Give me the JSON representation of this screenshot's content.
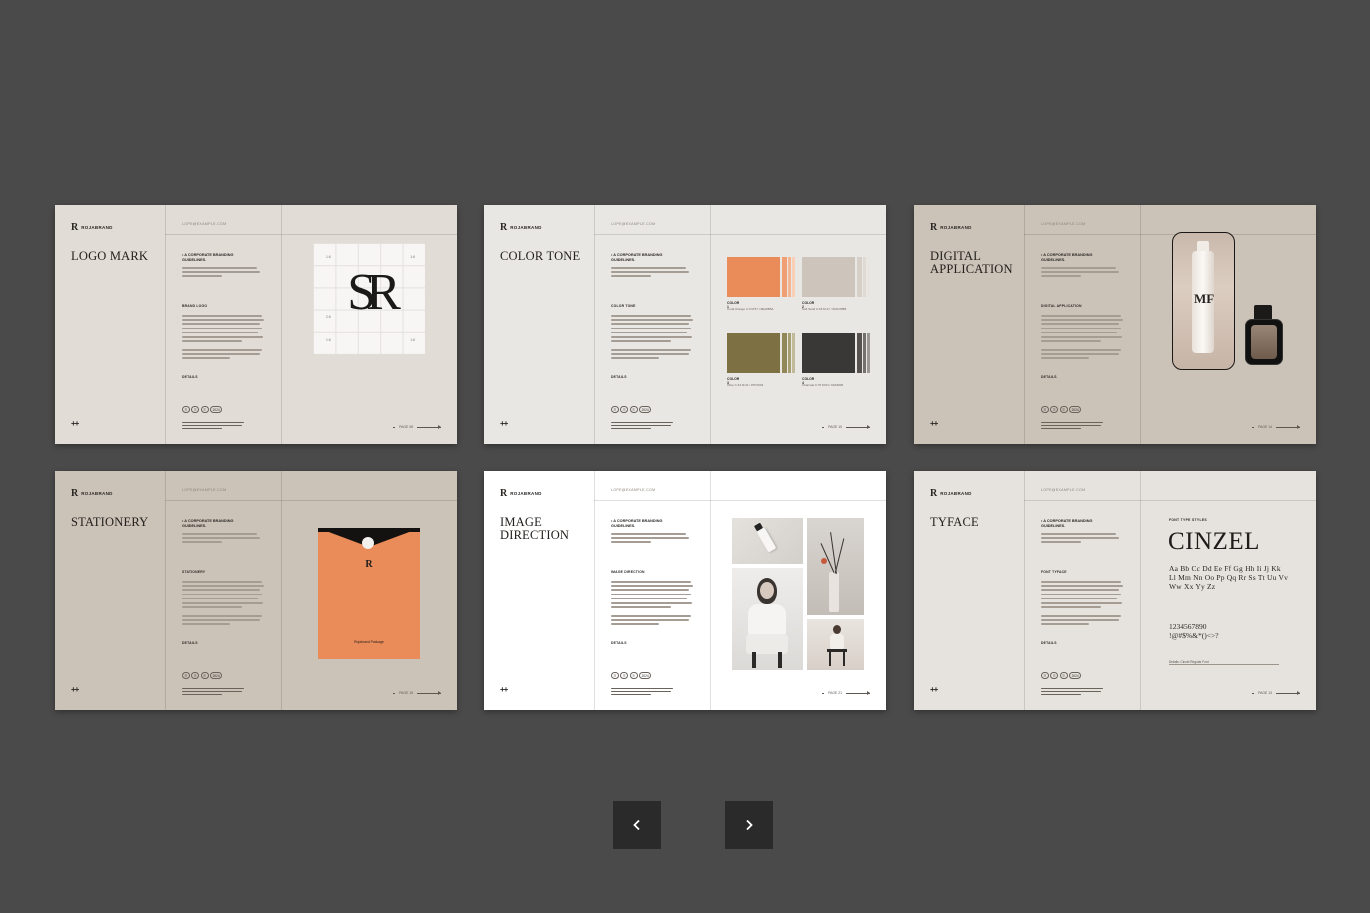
{
  "brand": {
    "mark": "R",
    "name_line1": "ROJABRAND",
    "name_line2": "STUDIO"
  },
  "common": {
    "email": "LOPE@EXAMPLE.COM",
    "guide_title": "• A CORPORATE BRANDING GUIDELINES.",
    "chips": [
      "☰",
      "☰",
      "☰",
      "2024"
    ],
    "details_label": "DETAILS",
    "plus": "++"
  },
  "colors": {
    "background_light": "#e6e2dd",
    "background_taupe": "#cbc2b8",
    "accent_orange": "#ea8b5a",
    "olive": "#7d7043",
    "sand": "#cdc5bb",
    "charcoal": "#3a3836",
    "app_background": "#4b4a4a",
    "button_background": "#2a2a2a"
  },
  "slides": [
    {
      "title": "Logo Mark",
      "section": "BRAND LOGO",
      "page": "PAGE 08",
      "visual": {
        "monogram": "SR",
        "ticks": [
          "1:6",
          "1:6",
          "2:6",
          "1:6",
          "1:6"
        ]
      }
    },
    {
      "title": "Color Tone",
      "section": "COLOR TONE",
      "page": "PAGE 10",
      "visual": {
        "swatches": [
          {
            "label": "COLOR 1",
            "sub": "Coral Orange C:0 M:57 / #EA8B5A",
            "color": "#ea8b5a",
            "stripes": [
              "#ef9f73",
              "#f4b592",
              "#f9cfb6"
            ]
          },
          {
            "label": "COLOR 2",
            "sub": "Soft Sand C:18 M:17 / #CDC5BB",
            "color": "#cdc5bb",
            "stripes": [
              "#d6d0c8",
              "#dfdad4",
              "#e8e4df"
            ]
          },
          {
            "label": "COLOR 3",
            "sub": "Olive C:43 M:41 / #7D7043",
            "color": "#7d7043",
            "stripes": [
              "#928759",
              "#a79f74",
              "#c0ba98"
            ]
          },
          {
            "label": "COLOR 4",
            "sub": "Charcoal C:70 M:64 / #3A3836",
            "color": "#3a3836",
            "stripes": [
              "#555250",
              "#73706d",
              "#9a9895"
            ]
          }
        ]
      }
    },
    {
      "title": "Digital Application",
      "section": "DIGITAL APPLICATION",
      "page": "PAGE 14",
      "visual": {
        "bottle_logo": "MF"
      }
    },
    {
      "title": "Stationery",
      "section": "STATIONERY",
      "page": "PAGE 15",
      "visual": {
        "envelope_mark": "R",
        "envelope_text": "Rojabrand Package"
      }
    },
    {
      "title": "Image Direction",
      "section": "IMAGE DIRECTION",
      "page": "PAGE 21",
      "visual": {}
    },
    {
      "title": "Tyface",
      "section": "FONT TYFACE",
      "page": "PAGE 13",
      "visual": {
        "font_label": "FONT TYPE STYLES",
        "font_name": "CINZEL",
        "alphabet": "Aa Bb Cc Dd Ee Ff Gg Hh Ii Jj Kk Ll Mm Nn Oo Pp Qq Rr Ss Tt Uu Vv Ww Xx Yy Zz",
        "numbers": "1234567890",
        "symbols": "!@#$%&*()<>?",
        "details": "Details: Cinzel Regular Font"
      }
    }
  ],
  "navigation": {
    "prev": "previous-slide",
    "next": "next-slide"
  }
}
